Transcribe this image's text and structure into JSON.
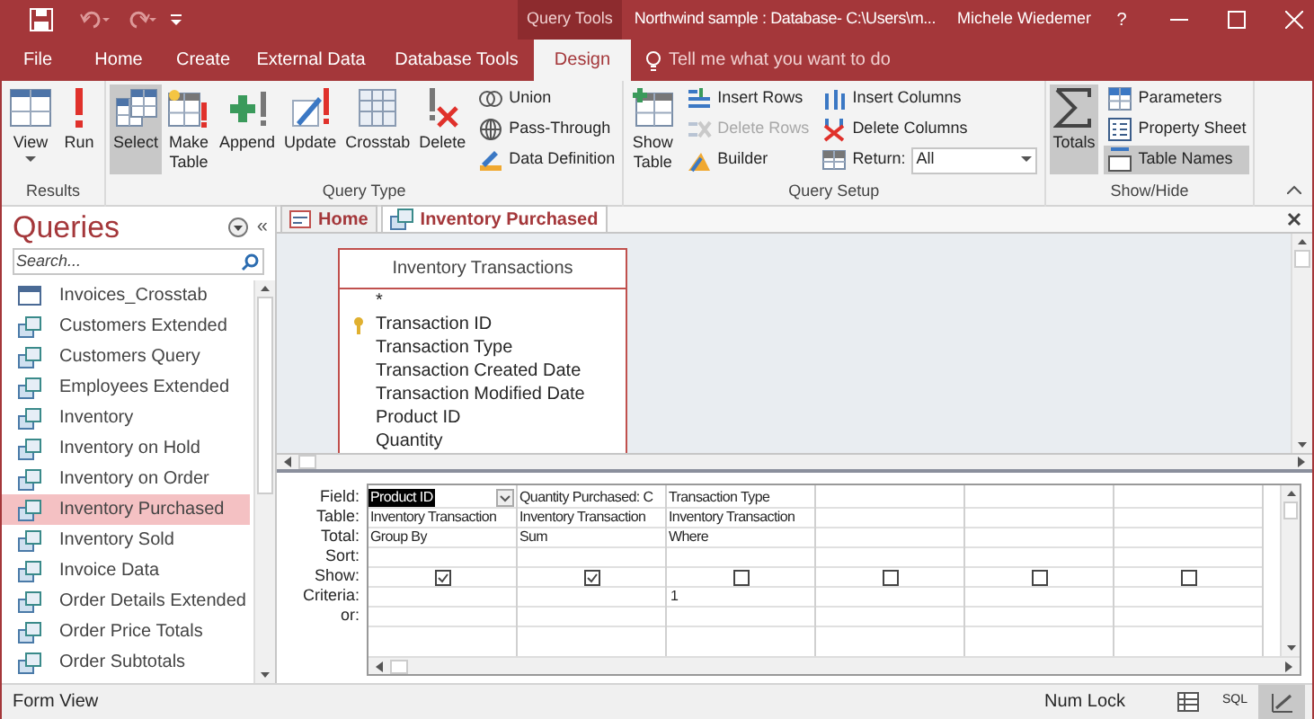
{
  "title_bar": {
    "context_label": "Query Tools",
    "title": "Northwind sample : Database- C:\\Users\\m...",
    "user": "Michele Wiedemer",
    "help": "?"
  },
  "tabs": [
    {
      "label": "File",
      "selected": false
    },
    {
      "label": "Home",
      "selected": false
    },
    {
      "label": "Create",
      "selected": false
    },
    {
      "label": "External Data",
      "selected": false
    },
    {
      "label": "Database Tools",
      "selected": false
    },
    {
      "label": "Design",
      "selected": true
    }
  ],
  "tell_me": {
    "placeholder": "Tell me what you want to do"
  },
  "ribbon_groups": [
    {
      "label": "Results",
      "large": [
        {
          "kind": "view",
          "label": "View",
          "menu": true
        },
        {
          "kind": "run",
          "label": "Run",
          "menu": false
        }
      ]
    },
    {
      "label": "Query Type",
      "large": [
        {
          "kind": "select",
          "label": "Select",
          "selected": true
        },
        {
          "kind": "maketable",
          "label": "Make Table",
          "selected": false
        },
        {
          "kind": "append",
          "label": "Append",
          "selected": false
        },
        {
          "kind": "update",
          "label": "Update",
          "selected": false
        },
        {
          "kind": "crosstab",
          "label": "Crosstab",
          "selected": false
        },
        {
          "kind": "delete",
          "label": "Delete",
          "selected": false
        }
      ],
      "small": [
        {
          "kind": "union",
          "label": "Union"
        },
        {
          "kind": "passthrough",
          "label": "Pass-Through"
        },
        {
          "kind": "datadef",
          "label": "Data Definition"
        }
      ]
    },
    {
      "label": "Query Setup",
      "large": [
        {
          "kind": "showtable",
          "label": "Show Table"
        }
      ],
      "small": [
        {
          "kind": "insertrows",
          "label": "Insert Rows",
          "disabled": false
        },
        {
          "kind": "deleterows",
          "label": "Delete Rows",
          "disabled": true
        },
        {
          "kind": "builder",
          "label": "Builder",
          "disabled": false
        },
        {
          "kind": "insertcols",
          "label": "Insert Columns",
          "disabled": false
        },
        {
          "kind": "deletecols",
          "label": "Delete Columns",
          "disabled": false
        },
        {
          "kind": "return",
          "label": "Return:",
          "value": "All"
        }
      ]
    },
    {
      "label": "Show/Hide",
      "large": [
        {
          "kind": "totals",
          "label": "Totals",
          "selected": true
        }
      ],
      "small": [
        {
          "kind": "parameters",
          "label": "Parameters",
          "selected": false
        },
        {
          "kind": "propertysheet",
          "label": "Property Sheet",
          "selected": false
        },
        {
          "kind": "tablenames",
          "label": "Table Names",
          "selected": true
        }
      ]
    }
  ],
  "nav_pane": {
    "title": "Queries",
    "collapse": "«",
    "search": {
      "placeholder": "Search..."
    },
    "items": [
      {
        "label": "Invoices_Crosstab",
        "kind": "crosstab",
        "selected": false
      },
      {
        "label": "Customers Extended",
        "kind": "select",
        "selected": false
      },
      {
        "label": "Customers Query",
        "kind": "select",
        "selected": false
      },
      {
        "label": "Employees Extended",
        "kind": "select",
        "selected": false
      },
      {
        "label": "Inventory",
        "kind": "select",
        "selected": false
      },
      {
        "label": "Inventory on Hold",
        "kind": "select",
        "selected": false
      },
      {
        "label": "Inventory on Order",
        "kind": "select",
        "selected": false
      },
      {
        "label": "Inventory Purchased",
        "kind": "select",
        "selected": true
      },
      {
        "label": "Inventory Sold",
        "kind": "select",
        "selected": false
      },
      {
        "label": "Invoice Data",
        "kind": "select",
        "selected": false
      },
      {
        "label": "Order Details Extended",
        "kind": "select",
        "selected": false
      },
      {
        "label": "Order Price Totals",
        "kind": "select",
        "selected": false
      },
      {
        "label": "Order Subtotals",
        "kind": "select",
        "selected": false
      }
    ]
  },
  "document_tabs": [
    {
      "label": "Home",
      "kind": "form",
      "selected": false
    },
    {
      "label": "Inventory Purchased",
      "kind": "query",
      "selected": true
    }
  ],
  "table_box": {
    "title": "Inventory Transactions",
    "fields": [
      {
        "label": "*",
        "key": false
      },
      {
        "label": "Transaction ID",
        "key": true
      },
      {
        "label": "Transaction Type",
        "key": false
      },
      {
        "label": "Transaction Created Date",
        "key": false
      },
      {
        "label": "Transaction Modified Date",
        "key": false
      },
      {
        "label": "Product ID",
        "key": false
      },
      {
        "label": "Quantity",
        "key": false
      }
    ]
  },
  "grid": {
    "row_labels": [
      "Field:",
      "Table:",
      "Total:",
      "Sort:",
      "Show:",
      "Criteria:",
      "or:"
    ],
    "columns": [
      {
        "field": "Product ID",
        "table": "Inventory Transaction",
        "total": "Group By",
        "show": true,
        "selected": true
      },
      {
        "field": "Quantity Purchased: C",
        "table": "Inventory Transaction",
        "total": "Sum",
        "show": true,
        "selected": false
      },
      {
        "field": "Transaction Type",
        "table": "Inventory Transaction",
        "total": "Where",
        "show": false,
        "criteria": "1",
        "selected": false
      },
      {
        "show": false,
        "selected": false
      },
      {
        "show": false,
        "selected": false
      },
      {
        "show": false,
        "selected": false
      }
    ]
  },
  "status_bar": {
    "left": "Form View",
    "num_lock": "Num Lock",
    "views": [
      {
        "kind": "datasheet",
        "selected": false
      },
      {
        "kind": "sql",
        "label": "SQL",
        "selected": false
      },
      {
        "kind": "design",
        "selected": true
      }
    ]
  }
}
